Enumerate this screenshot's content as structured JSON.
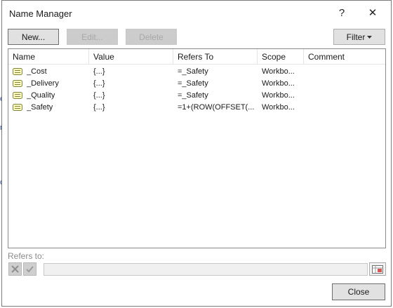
{
  "window": {
    "title": "Name Manager",
    "help_glyph": "?",
    "close_glyph": "✕"
  },
  "toolbar": {
    "new_label": "New...",
    "edit_label": "Edit...",
    "delete_label": "Delete",
    "filter_label": "Filter"
  },
  "columns": [
    "Name",
    "Value",
    "Refers To",
    "Scope",
    "Comment"
  ],
  "names": [
    {
      "name": "_Cost",
      "value": "{...}",
      "refers_to": "=_Safety",
      "scope": "Workbo...",
      "comment": ""
    },
    {
      "name": "_Delivery",
      "value": "{...}",
      "refers_to": "=_Safety",
      "scope": "Workbo...",
      "comment": ""
    },
    {
      "name": "_Quality",
      "value": "{...}",
      "refers_to": "=_Safety",
      "scope": "Workbo...",
      "comment": ""
    },
    {
      "name": "_Safety",
      "value": "{...}",
      "refers_to": "=1+(ROW(OFFSET(...",
      "scope": "Workbo...",
      "comment": ""
    }
  ],
  "refers_to_section": {
    "label": "Refers to:",
    "value": ""
  },
  "footer": {
    "close_label": "Close"
  },
  "colors": {
    "icon_fill": "#fff7c2",
    "icon_stroke": "#7a8a3a",
    "cancel_x": "#8e8e8e",
    "accept_check": "#9a9a9a"
  }
}
